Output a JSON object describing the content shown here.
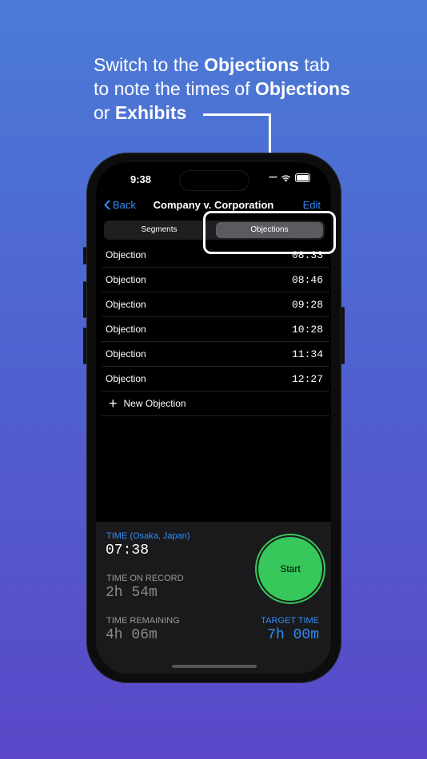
{
  "caption": {
    "line1_pre": "Switch to the ",
    "line1_bold": "Objections",
    "line1_post": " tab",
    "line2_pre": "to note the times of ",
    "line2_bold": "Objections",
    "line3_pre": "or ",
    "line3_bold": "Exhibits"
  },
  "status": {
    "time": "9:38"
  },
  "nav": {
    "back_label": "Back",
    "title": "Company v. Corporation",
    "edit_label": "Edit"
  },
  "segments": {
    "first": "Segments",
    "second": "Objections",
    "selected": "Objections"
  },
  "objections": [
    {
      "label": "Objection",
      "time": "08:33"
    },
    {
      "label": "Objection",
      "time": "08:46"
    },
    {
      "label": "Objection",
      "time": "09:28"
    },
    {
      "label": "Objection",
      "time": "10:28"
    },
    {
      "label": "Objection",
      "time": "11:34"
    },
    {
      "label": "Objection",
      "time": "12:27"
    }
  ],
  "new_objection_label": "New Objection",
  "panel": {
    "time_label": "TIME (Osaka, Japan)",
    "time_value": "07:38",
    "on_record_label": "TIME ON RECORD",
    "on_record_value": "2h 54m",
    "remaining_label": "TIME REMAINING",
    "remaining_value": "4h 06m",
    "target_label": "TARGET TIME",
    "target_value": "7h 00m",
    "start_label": "Start"
  },
  "colors": {
    "accent": "#2f8cf5",
    "start": "#36c85a",
    "background_top": "#4a7bd6",
    "background_bottom": "#5a48c8"
  }
}
